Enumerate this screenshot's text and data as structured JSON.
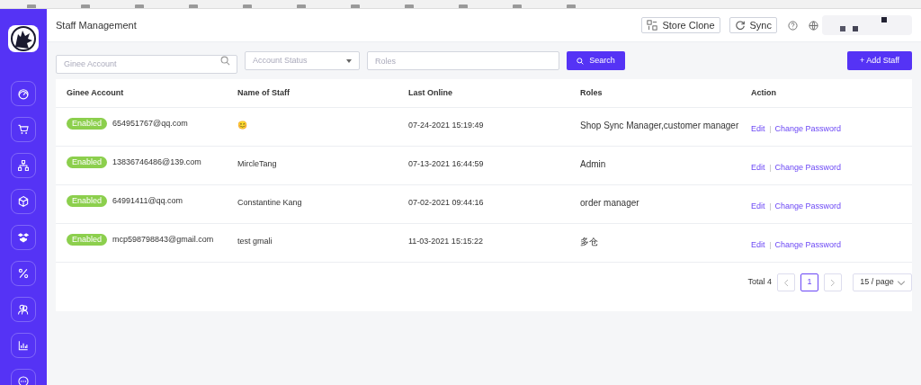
{
  "header": {
    "title": "Staff Management",
    "buttons": [
      {
        "kind": "clone",
        "label": "Store Clone"
      },
      {
        "kind": "sync",
        "label": "Sync"
      }
    ]
  },
  "sidebar": {
    "items": [
      {
        "kind": "dashboard"
      },
      {
        "kind": "cart"
      },
      {
        "kind": "hierarchy"
      },
      {
        "kind": "cube"
      },
      {
        "kind": "boxes"
      },
      {
        "kind": "percent"
      },
      {
        "kind": "users"
      },
      {
        "kind": "chart"
      },
      {
        "kind": "chat"
      }
    ]
  },
  "filters": {
    "account": {
      "placeholder": "Ginee Account"
    },
    "status": {
      "placeholder": "Account Status"
    },
    "roles": {
      "placeholder": "Roles"
    },
    "search_button": "Search",
    "add_button": "+ Add Staff"
  },
  "table": {
    "columns": [
      "Ginee Account",
      "Name of Staff",
      "Last Online",
      "Roles",
      "Action"
    ],
    "rows": [
      {
        "status": "Enabled",
        "account": "654951767@qq.com",
        "name": "😊",
        "last_online": "07-24-2021 15:19:49",
        "roles": "Shop Sync Manager,customer manager",
        "actions": [
          "Edit",
          "Change Password"
        ]
      },
      {
        "status": "Enabled",
        "account": "13836746486@139.com",
        "name": "MircleTang",
        "last_online": "07-13-2021 16:44:59",
        "roles": "Admin",
        "actions": [
          "Edit",
          "Change Password"
        ]
      },
      {
        "status": "Enabled",
        "account": "64991411@qq.com",
        "name": "Constantine Kang",
        "last_online": "07-02-2021 09:44:16",
        "roles": "order manager",
        "actions": [
          "Edit",
          "Change Password"
        ]
      },
      {
        "status": "Enabled",
        "account": "mcp598798843@gmail.com",
        "name": "test gmali",
        "last_online": "11-03-2021 15:15:22",
        "roles": "多仓",
        "actions": [
          "Edit",
          "Change Password"
        ]
      }
    ]
  },
  "pagination": {
    "total": "Total 4",
    "pages": [
      {
        "label": "1",
        "selected": true
      }
    ],
    "page_size": "15 / page"
  }
}
